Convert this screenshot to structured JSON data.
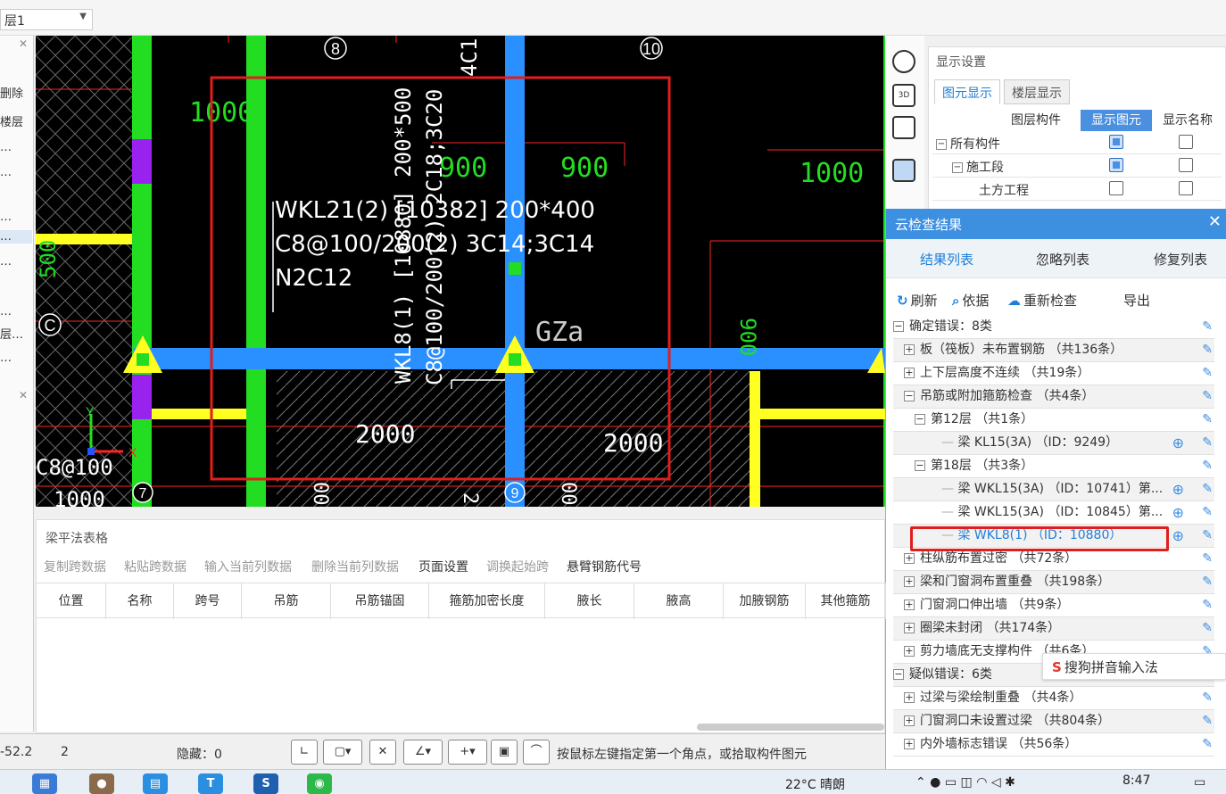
{
  "floor_select": {
    "value": "层1"
  },
  "left_panel": {
    "items": [
      "删除",
      "楼层",
      "…",
      "…",
      "…",
      "…",
      "…",
      "…",
      "层…",
      "…"
    ]
  },
  "cad": {
    "grid_labels": [
      "8",
      "10",
      "C",
      "7",
      "9"
    ],
    "dims": [
      "1000",
      "900",
      "900",
      "1000",
      "500",
      "900",
      "2000",
      "2000",
      "1000",
      "000",
      "000",
      "2"
    ],
    "beam_label_lines": [
      "WKL21(2) [10382] 200*400",
      "C8@100/200(2) 3C14;3C14",
      "N2C12"
    ],
    "vert_beam_label": "WKL8(1) [10880] 200*500",
    "vert_beam_label2": "C8@100/200(2) 2C18;3C20",
    "top_label": "4C1",
    "column_label": "GZa",
    "bottom_left_label": "C8@100",
    "axis_x": "X",
    "axis_y": "Y"
  },
  "display_settings": {
    "title": "显示设置",
    "tabs": [
      "图元显示",
      "楼层显示"
    ],
    "columns": [
      "图层构件",
      "显示图元",
      "显示名称"
    ],
    "rows": [
      {
        "label": "所有构件",
        "show": true,
        "name": false
      },
      {
        "label": "施工段",
        "show": true,
        "name": false
      },
      {
        "label": "土方工程",
        "show": false,
        "name": false
      }
    ]
  },
  "cloud_check": {
    "title": "云检查结果",
    "tabs": [
      "结果列表",
      "忽略列表",
      "修复列表"
    ],
    "actions": [
      "刷新",
      "依据",
      "重新检查",
      "导出"
    ],
    "rows": [
      {
        "text": "确定错误：8类",
        "level": 0,
        "exp": "−"
      },
      {
        "text": "板（筏板）未布置钢筋 （共136条）",
        "level": 1,
        "exp": "+"
      },
      {
        "text": "上下层高度不连续 （共19条）",
        "level": 1,
        "exp": "+"
      },
      {
        "text": "吊筋或附加箍筋检查 （共4条）",
        "level": 1,
        "exp": "−"
      },
      {
        "text": "第12层 （共1条）",
        "level": 2,
        "exp": "−"
      },
      {
        "text": "梁 KL15(3A) （ID：9249）",
        "level": 3,
        "exp": ""
      },
      {
        "text": "第18层 （共3条）",
        "level": 2,
        "exp": "−"
      },
      {
        "text": "梁 WKL15(3A) （ID：10741）第...",
        "level": 3,
        "exp": ""
      },
      {
        "text": "梁 WKL15(3A) （ID：10845）第...",
        "level": 3,
        "exp": ""
      },
      {
        "text": "梁 WKL8(1) （ID：10880）",
        "level": 3,
        "exp": ""
      },
      {
        "text": "柱纵筋布置过密 （共72条）",
        "level": 1,
        "exp": "+"
      },
      {
        "text": "梁和门窗洞布置重叠 （共198条）",
        "level": 1,
        "exp": "+"
      },
      {
        "text": "门窗洞口伸出墙 （共9条）",
        "level": 1,
        "exp": "+"
      },
      {
        "text": "圈梁未封闭 （共174条）",
        "level": 1,
        "exp": "+"
      },
      {
        "text": "剪力墙底无支撑构件 （共6条）",
        "level": 1,
        "exp": "+"
      },
      {
        "text": "疑似错误：6类",
        "level": 0,
        "exp": "−"
      },
      {
        "text": "过梁与梁绘制重叠 （共4条）",
        "level": 1,
        "exp": "+"
      },
      {
        "text": "门窗洞口未设置过梁 （共804条）",
        "level": 1,
        "exp": "+"
      },
      {
        "text": "内外墙标志错误 （共56条）",
        "level": 1,
        "exp": "+"
      }
    ],
    "ime": "搜狗拼音输入法"
  },
  "beam_table": {
    "title": "梁平法表格",
    "toolbar": [
      "复制跨数据",
      "粘贴跨数据",
      "输入当前列数据",
      "删除当前列数据",
      "页面设置",
      "调换起始跨",
      "悬臂钢筋代号"
    ],
    "columns": [
      "位置",
      "名称",
      "跨号",
      "吊筋",
      "吊筋锚固",
      "箍筋加密长度",
      "腋长",
      "腋高",
      "加腋钢筋",
      "其他箍筋"
    ]
  },
  "status": {
    "coord": "-52.2",
    "layer": "2",
    "hidden": "隐藏：0",
    "hint": "按鼠标左键指定第一个角点，或拾取构件图元"
  },
  "taskbar": {
    "weather": "22°C 晴朗",
    "time": "8:47"
  },
  "colors": {
    "accent": "#3d8fe0",
    "highlight_red": "#e01e1e",
    "beam_blue": "#2a8fff",
    "column_green": "#22cc22",
    "yellow": "#ffff22"
  }
}
